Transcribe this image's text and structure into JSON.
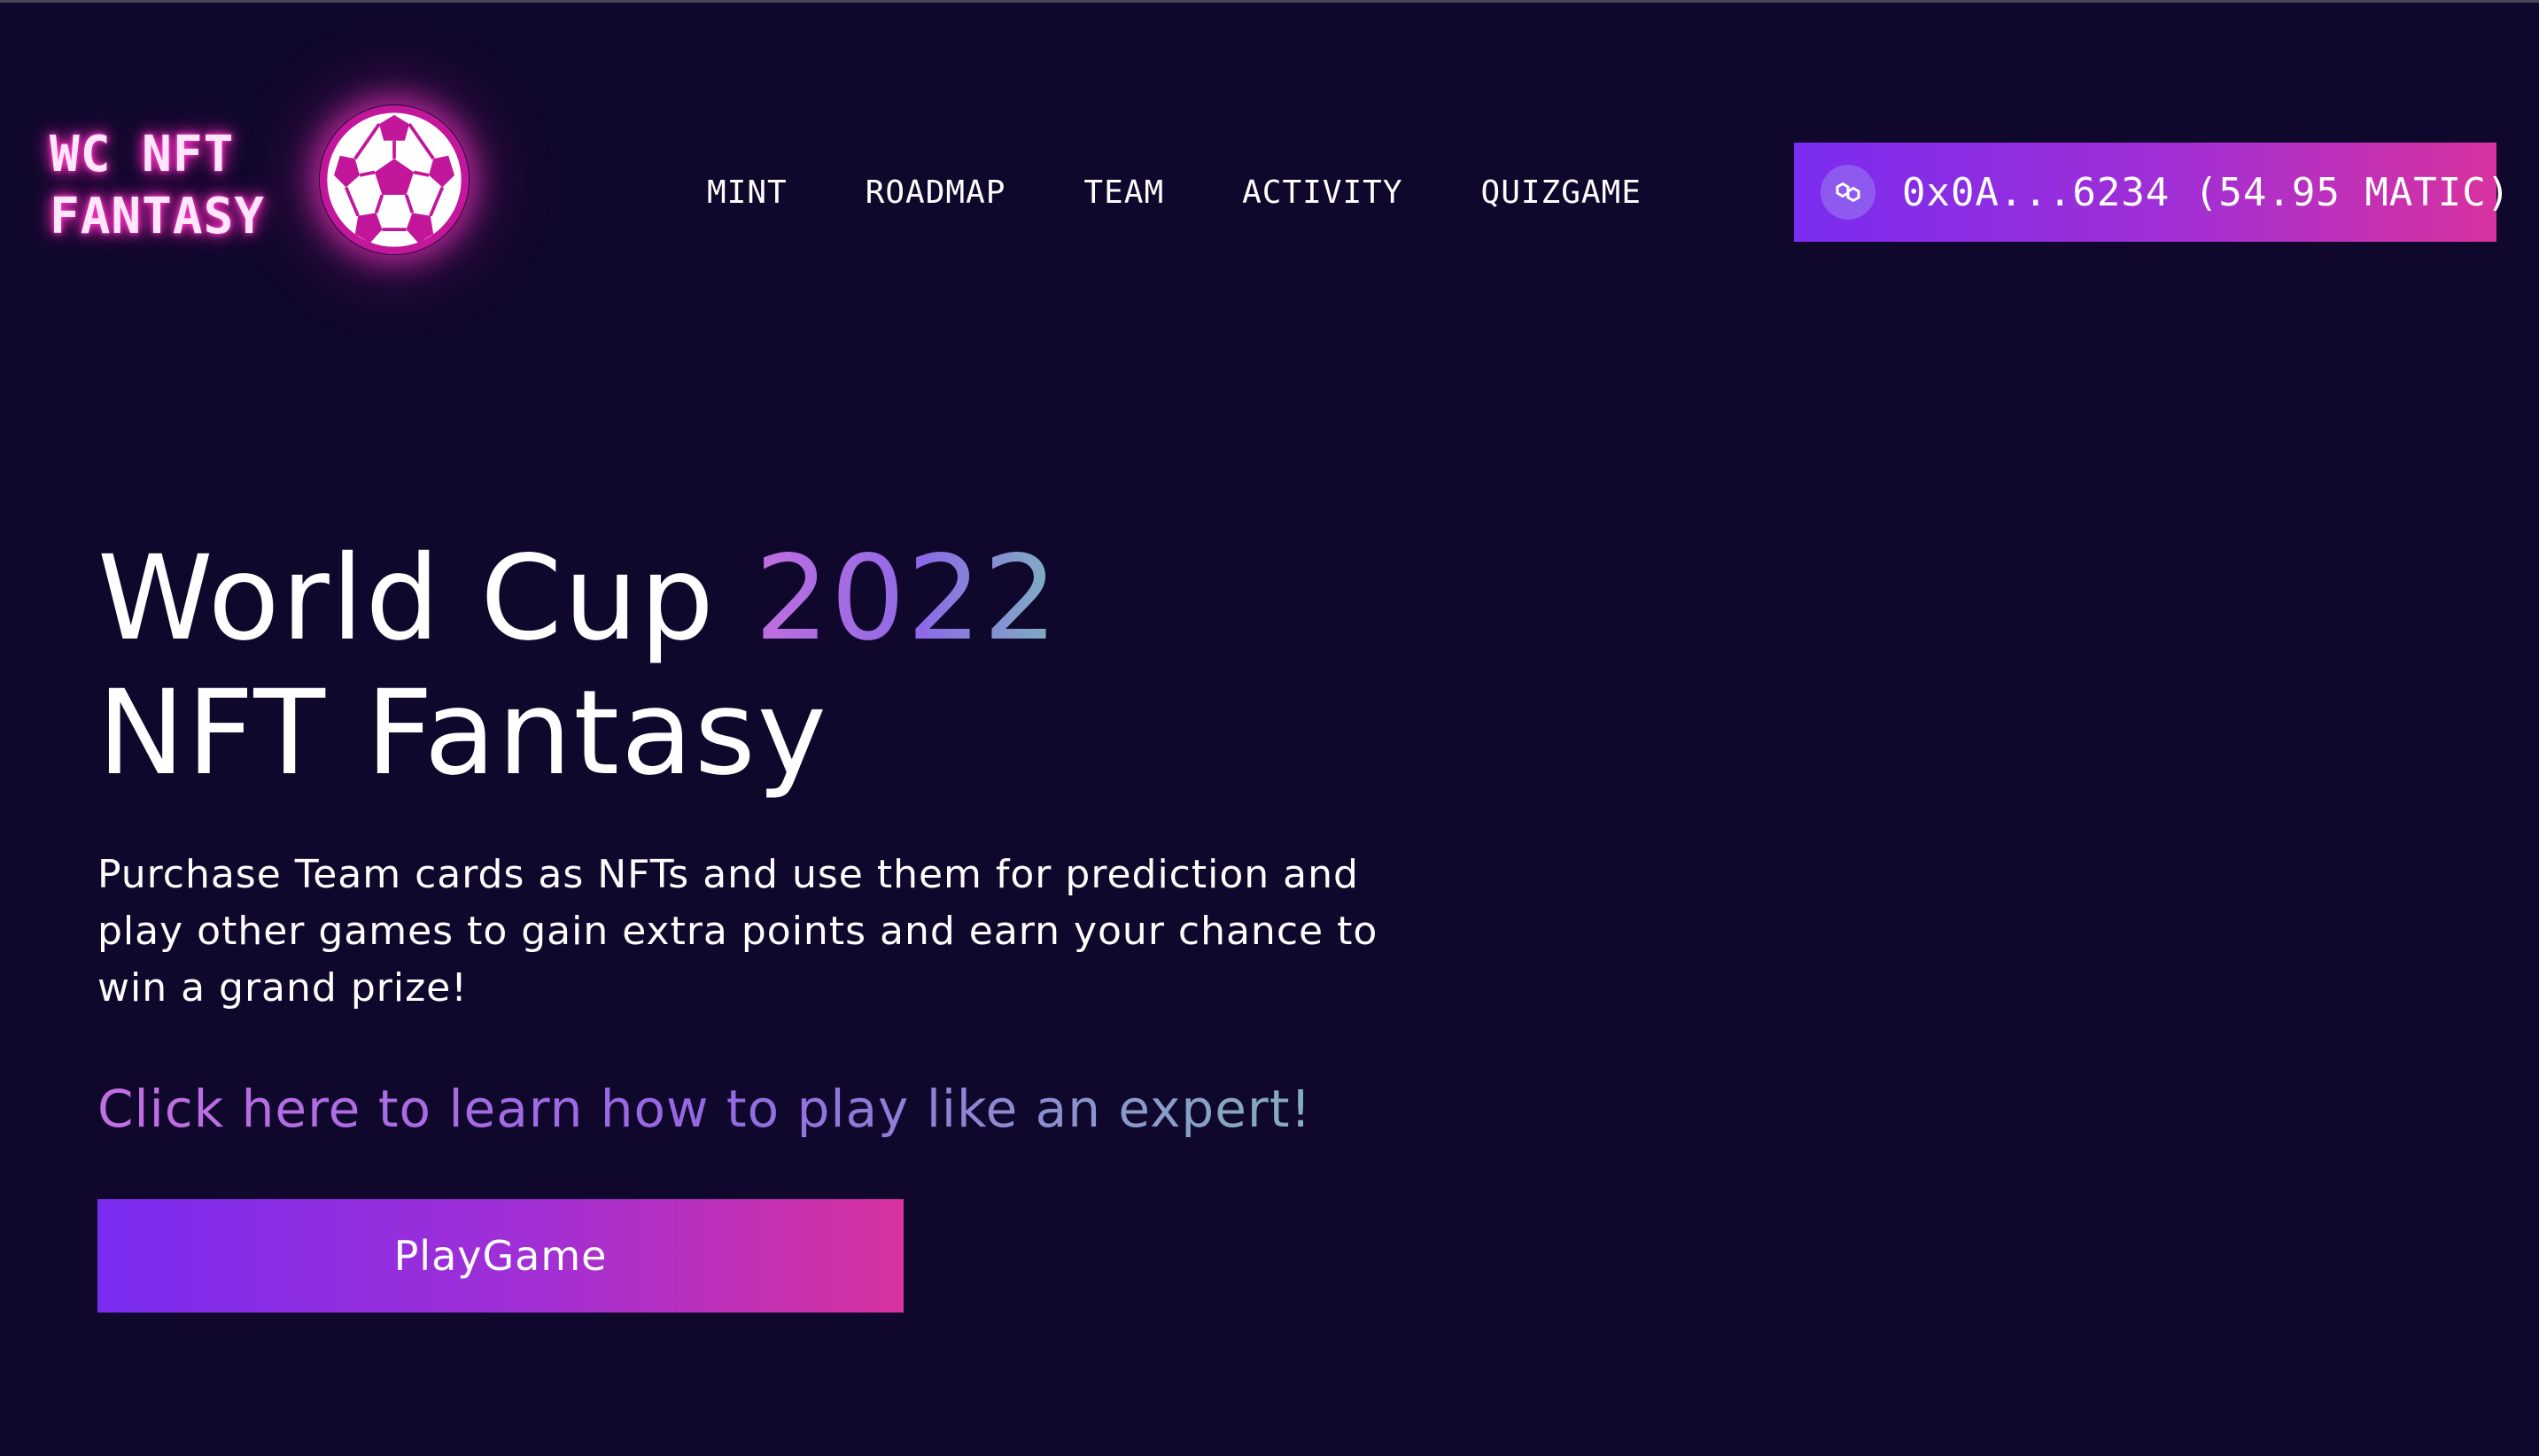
{
  "brand": {
    "logo_line1": "WC NFT",
    "logo_line2": "FANTASY",
    "logo_icon": "soccer-ball-icon"
  },
  "nav": {
    "items": [
      {
        "label": "MINT"
      },
      {
        "label": "ROADMAP"
      },
      {
        "label": "TEAM"
      },
      {
        "label": "ACTIVITY"
      },
      {
        "label": "QUIZGAME"
      }
    ]
  },
  "wallet": {
    "icon": "polygon-matic-icon",
    "label": "0x0A...6234 (54.95 MATIC)"
  },
  "hero": {
    "title_part1": "World Cup ",
    "title_highlight": "2022",
    "title_line2": "NFT Fantasy",
    "description": "Purchase Team cards as NFTs and use them for prediction and play other games to gain extra points and earn your chance to win a grand prize!",
    "learn_link": "Click here to learn how to play like an expert!",
    "play_button": "PlayGame"
  },
  "colors": {
    "background": "#10082c",
    "gradient_start": "#7a2cf0",
    "gradient_end": "#d8329f",
    "neon_pink": "#ff3cc8"
  }
}
